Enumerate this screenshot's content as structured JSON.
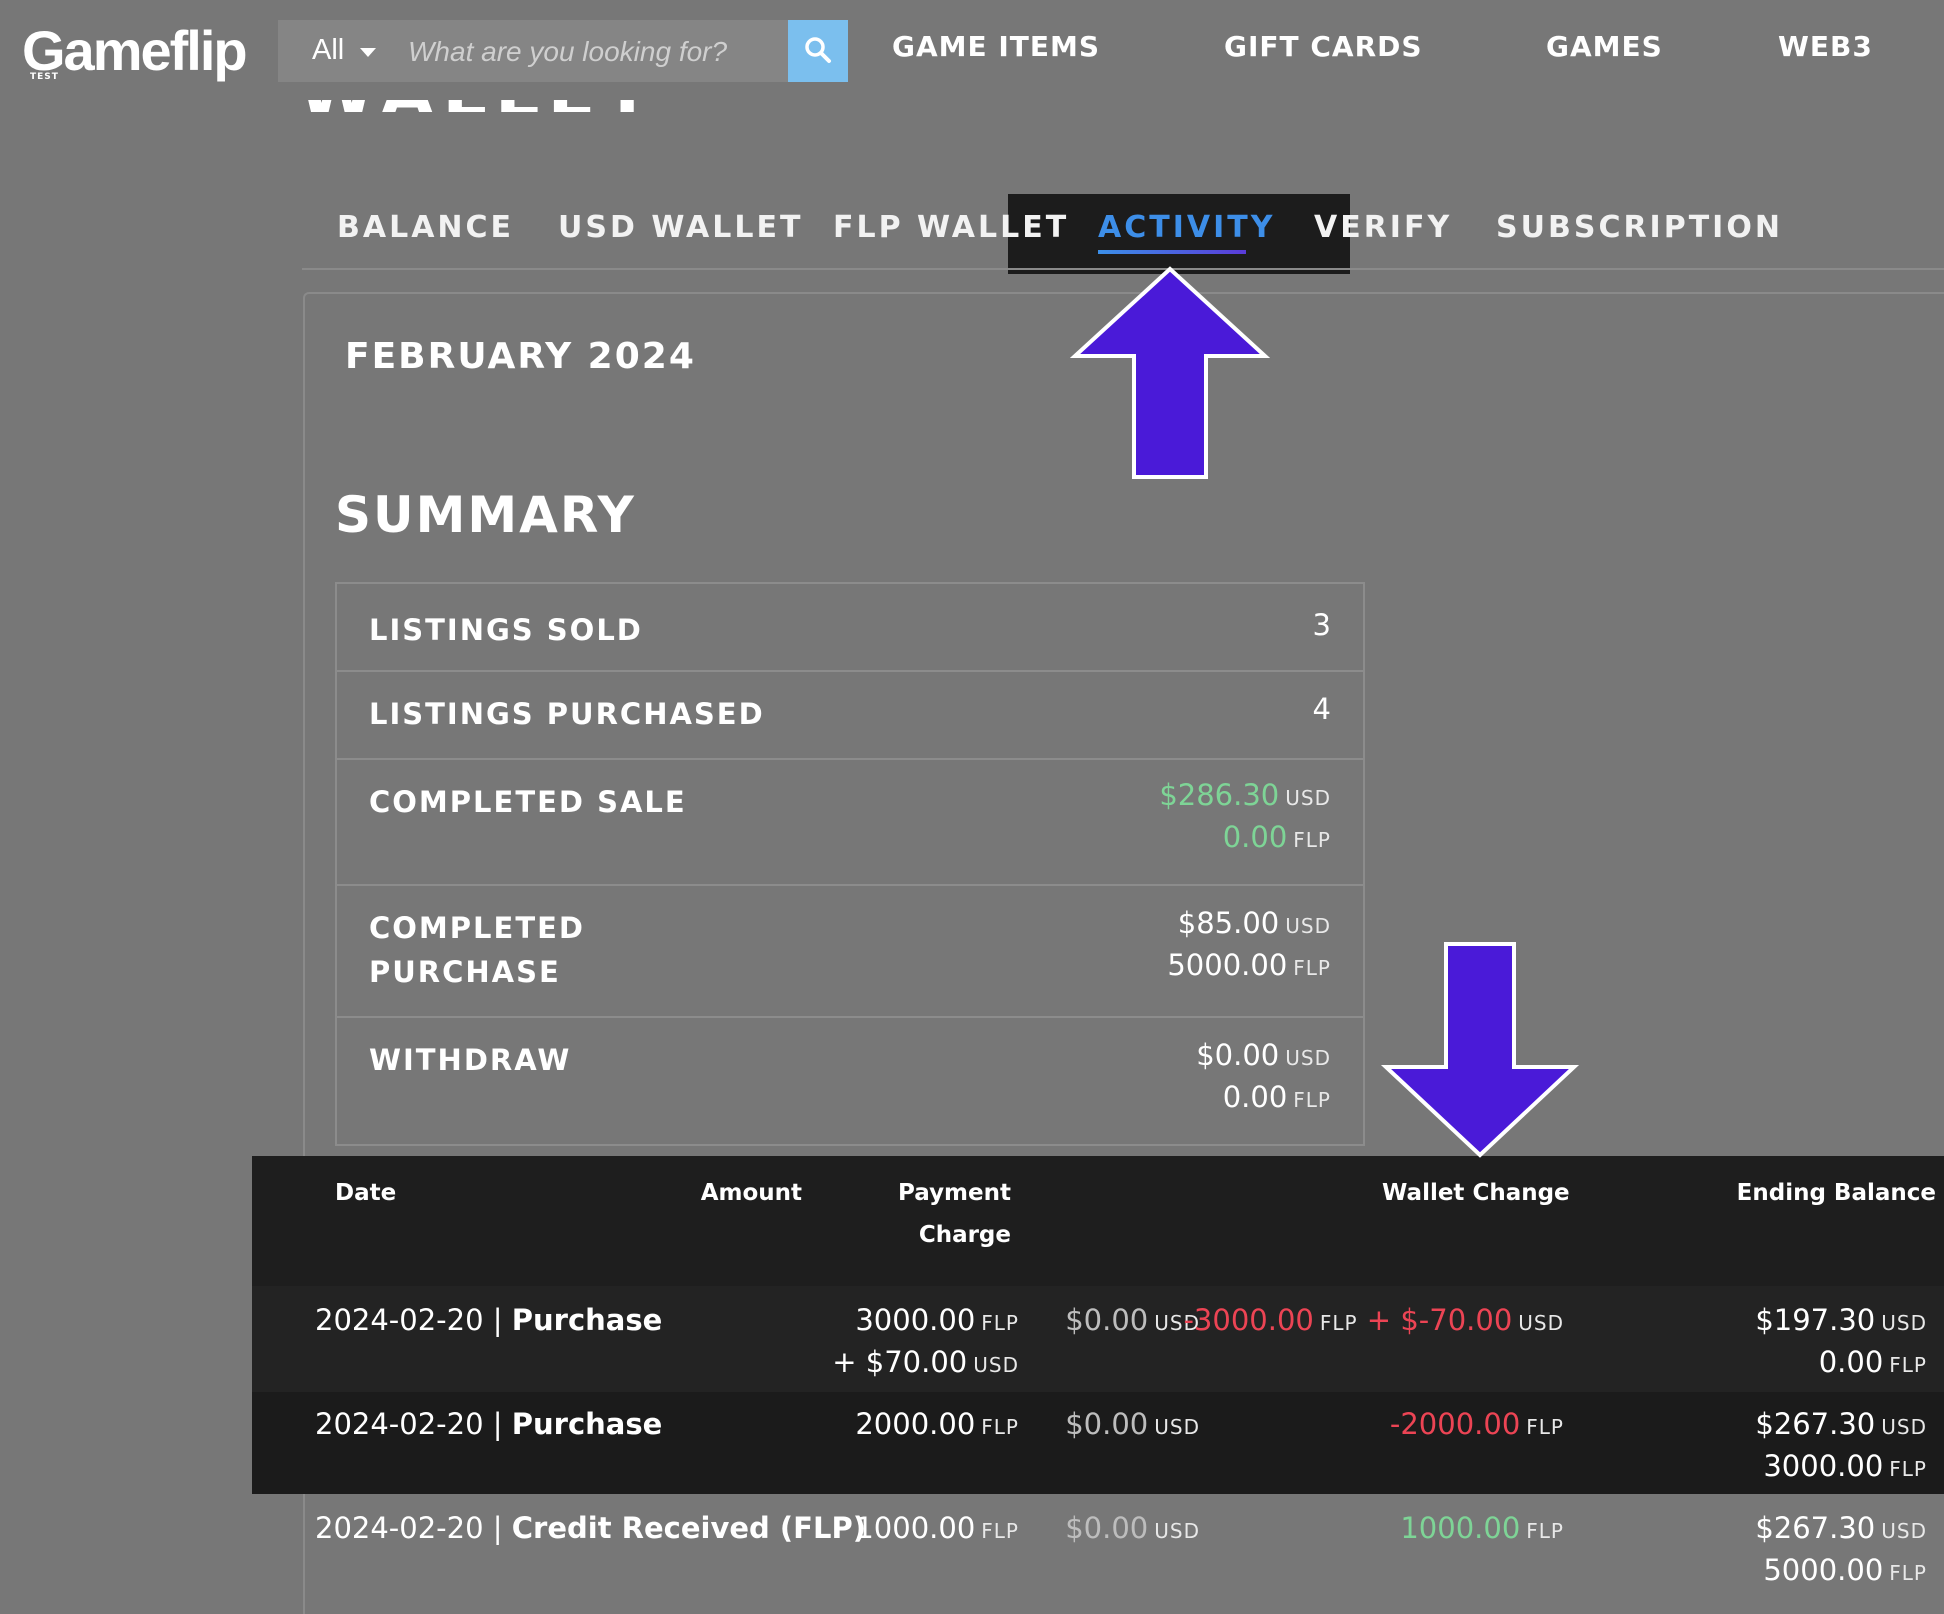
{
  "header": {
    "logo": "Gameflip",
    "logo_sub": "TEST",
    "search_category": "All",
    "search_placeholder": "What are you looking for?",
    "nav": [
      "GAME ITEMS",
      "GIFT CARDS",
      "GAMES",
      "WEB3"
    ]
  },
  "page_title": "WALLET",
  "tabs": [
    "BALANCE",
    "USD WALLET",
    "FLP WALLET",
    "ACTIVITY",
    "VERIFY",
    "SUBSCRIPTION"
  ],
  "active_tab": "ACTIVITY",
  "month": "FEBRUARY 2024",
  "summary": {
    "title": "SUMMARY",
    "listings_sold_label": "LISTINGS SOLD",
    "listings_sold": "3",
    "listings_purchased_label": "LISTINGS PURCHASED",
    "listings_purchased": "4",
    "completed_sale_label": "COMPLETED SALE",
    "completed_sale_usd": "$286.30",
    "completed_sale_flp": "0.00",
    "completed_purchase_label_1": "COMPLETED",
    "completed_purchase_label_2": "PURCHASE",
    "completed_purchase_usd": "$85.00",
    "completed_purchase_flp": "5000.00",
    "withdraw_label": "WITHDRAW",
    "withdraw_usd": "$0.00",
    "withdraw_flp": "0.00",
    "unit_usd": "USD",
    "unit_flp": "FLP"
  },
  "activity": {
    "headers": {
      "date": "Date",
      "amount": "Amount",
      "payment_1": "Payment",
      "payment_2": "Charge",
      "wallet_change": "Wallet Change",
      "ending_balance": "Ending Balance"
    },
    "rows": [
      {
        "date": "2024-02-20",
        "sep": "|",
        "type": "Purchase",
        "amount_flp": "3000.00",
        "amount_usd": "+ $70.00",
        "payment": "$0.00",
        "change_flp": "-3000.00",
        "change_plus": "+",
        "change_usd": "$-70.00",
        "end_usd": "$197.30",
        "end_flp": "0.00"
      },
      {
        "date": "2024-02-20",
        "sep": "|",
        "type": "Purchase",
        "amount_flp": "2000.00",
        "payment": "$0.00",
        "change_flp": "-2000.00",
        "end_usd": "$267.30",
        "end_flp": "3000.00"
      },
      {
        "date": "2024-02-20",
        "sep": "|",
        "type": "Credit Received (FLP)",
        "amount_flp": "1000.00",
        "payment": "$0.00",
        "change_flp": "1000.00",
        "end_usd": "$267.30",
        "end_flp": "5000.00"
      }
    ]
  },
  "colors": {
    "background": "#777777",
    "accent_blue": "#3d8ee8",
    "positive": "#7ed496",
    "negative": "#ec4454",
    "arrow": "#4a1ad8",
    "search_button": "#7bbfee"
  }
}
